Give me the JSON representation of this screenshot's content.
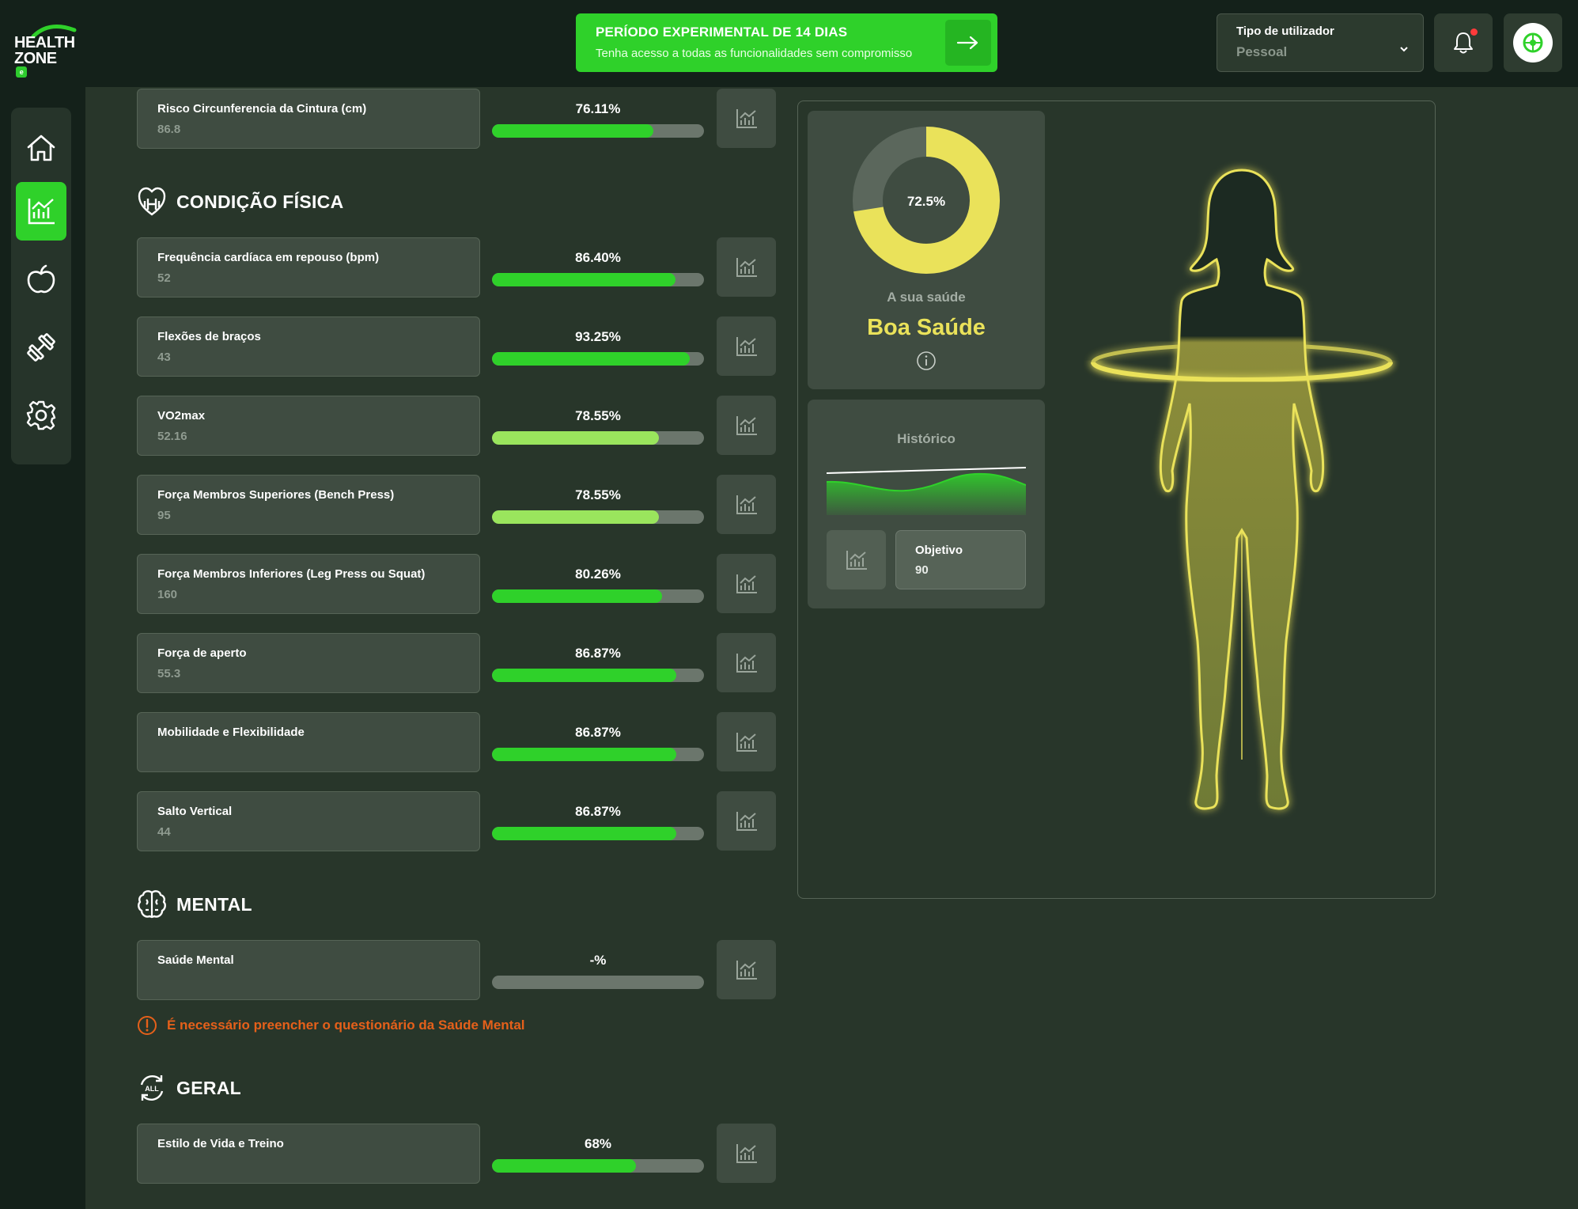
{
  "logo": {
    "line1": "HEALTH",
    "line2": "ZONE",
    "badge": "e"
  },
  "trial": {
    "title": "PERÍODO EXPERIMENTAL DE 14 DIAS",
    "subtitle": "Tenha acesso a todas as funcionalidades sem compromisso",
    "arrow_icon": "arrow-right-icon"
  },
  "user_type": {
    "label": "Tipo de utilizador",
    "value": "Pessoal"
  },
  "sidebar": {
    "items": [
      {
        "name": "home",
        "icon": "home-icon",
        "active": false
      },
      {
        "name": "stats",
        "icon": "chart-icon",
        "active": true
      },
      {
        "name": "nutrition",
        "icon": "apple-icon",
        "active": false
      },
      {
        "name": "training",
        "icon": "dumbbell-icon",
        "active": false
      },
      {
        "name": "settings",
        "icon": "gear-icon",
        "active": false
      }
    ]
  },
  "top_metric": {
    "name": "Risco Circunferencia da Cintura (cm)",
    "value": "86.8",
    "pct_label": "76.11%",
    "pct": 76.11,
    "color": "#2fd12a"
  },
  "sections": {
    "physical": {
      "title": "CONDIÇÃO FÍSICA",
      "metrics": [
        {
          "name": "Frequência cardíaca em repouso (bpm)",
          "value": "52",
          "pct_label": "86.40%",
          "pct": 86.4,
          "color": "#2fd12a"
        },
        {
          "name": "Flexões de braços",
          "value": "43",
          "pct_label": "93.25%",
          "pct": 93.25,
          "color": "#2fd12a"
        },
        {
          "name": "VO2max",
          "value": "52.16",
          "pct_label": "78.55%",
          "pct": 78.55,
          "color": "#9ae55d"
        },
        {
          "name": "Força Membros Superiores (Bench Press)",
          "value": "95",
          "pct_label": "78.55%",
          "pct": 78.55,
          "color": "#9ae55d"
        },
        {
          "name": "Força Membros Inferiores (Leg Press ou Squat)",
          "value": "160",
          "pct_label": "80.26%",
          "pct": 80.26,
          "color": "#2fd12a"
        },
        {
          "name": "Força de aperto",
          "value": "55.3",
          "pct_label": "86.87%",
          "pct": 86.87,
          "color": "#2fd12a"
        },
        {
          "name": "Mobilidade e Flexibilidade",
          "value": "",
          "pct_label": "86.87%",
          "pct": 86.87,
          "color": "#2fd12a"
        },
        {
          "name": "Salto Vertical",
          "value": "44",
          "pct_label": "86.87%",
          "pct": 86.87,
          "color": "#2fd12a"
        }
      ]
    },
    "mental": {
      "title": "MENTAL",
      "metrics": [
        {
          "name": "Saúde Mental",
          "value": "",
          "pct_label": "-%",
          "pct": 0,
          "color": "#2fd12a"
        }
      ],
      "warning": "É necessário preencher o questionário da Saúde Mental"
    },
    "general": {
      "title": "GERAL",
      "icon_text": "ALL",
      "metrics": [
        {
          "name": "Estilo de Vida e Treino",
          "value": "",
          "pct_label": "68%",
          "pct": 68,
          "color": "#2fd12a"
        }
      ]
    }
  },
  "health": {
    "score_label": "72.5%",
    "score": 72.5,
    "label": "A sua saúde",
    "status": "Boa Saúde",
    "colors": {
      "filled": "#eae25a",
      "empty": "#5b675c"
    }
  },
  "history": {
    "title": "Histórico",
    "goal_label": "Objetivo",
    "goal_value": "90"
  }
}
